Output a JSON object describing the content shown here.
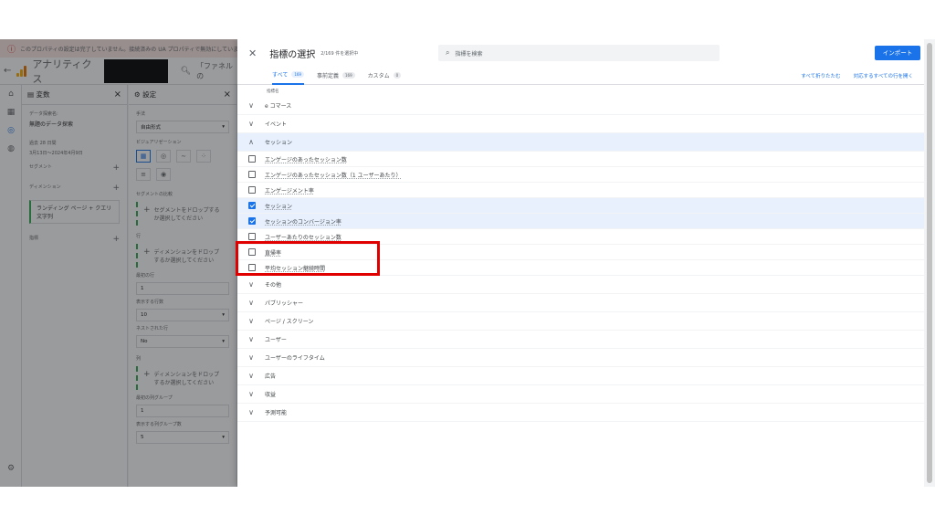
{
  "warning": {
    "text": "このプロパティの設定は完了していません。接続済みの UA プロパティで無効にしています"
  },
  "appbar": {
    "title": "アナリティクス",
    "search_text": "「ファネルの"
  },
  "variables": {
    "title": "変数",
    "exploration_label": "データ探索名:",
    "exploration_name": "無題のデータ探索",
    "date_label": "過去 28 日間",
    "date_range": "3月13日～2024年4月9日",
    "segments_label": "セグメント",
    "dimensions_label": "ディメンション",
    "dimension_chip": "ランディング ページ + クエリ文字列",
    "metrics_label": "指標"
  },
  "settings": {
    "title": "設定",
    "technique_label": "手法",
    "technique_value": "自由形式",
    "visualization_label": "ビジュアリゼーション",
    "segment_compare_label": "セグメントの比較",
    "segment_drop": "セグメントをドロップするか選択してください",
    "rows_label": "行",
    "rows_drop": "ディメンションをドロップするか選択してください",
    "first_row_label": "最初の行",
    "first_row_value": "1",
    "show_rows_label": "表示する行数",
    "show_rows_value": "10",
    "nested_rows_label": "ネストされた行",
    "nested_rows_value": "No",
    "cols_label": "列",
    "cols_drop": "ディメンションをドロップするか選択してください",
    "first_col_group_label": "最初の列グループ",
    "first_col_group_value": "1",
    "show_col_groups_label": "表示する列グループ数",
    "show_col_groups_value": "5"
  },
  "panel": {
    "title": "指標の選択",
    "count": "2/169 件を選択中",
    "search_placeholder": "指標を検索",
    "import_label": "インポート",
    "tabs": [
      {
        "label": "すべて",
        "badge": "169"
      },
      {
        "label": "事前定義",
        "badge": "169"
      },
      {
        "label": "カスタム",
        "badge": "0"
      }
    ],
    "collapse_all": "すべて折りたたむ",
    "expand_matches": "対応するすべての行を開く",
    "column_name": "指標名",
    "categories_top": [
      "e コマース",
      "イベント"
    ],
    "session_category": "セッション",
    "session_items": [
      {
        "label": "エンゲージのあったセッション数",
        "checked": false
      },
      {
        "label": "エンゲージのあったセッション数（1 ユーザーあたり）",
        "checked": false
      },
      {
        "label": "エンゲージメント率",
        "checked": false
      },
      {
        "label": "セッション",
        "checked": true
      },
      {
        "label": "セッションのコンバージョン率",
        "checked": true
      },
      {
        "label": "ユーザーあたりのセッション数",
        "checked": false
      },
      {
        "label": "直帰率",
        "checked": false
      },
      {
        "label": "平均セッション継続時間",
        "checked": false
      }
    ],
    "categories_bottom": [
      "その他",
      "パブリッシャー",
      "ページ / スクリーン",
      "ユーザー",
      "ユーザーのライフタイム",
      "広告",
      "収益",
      "予測可能"
    ]
  }
}
